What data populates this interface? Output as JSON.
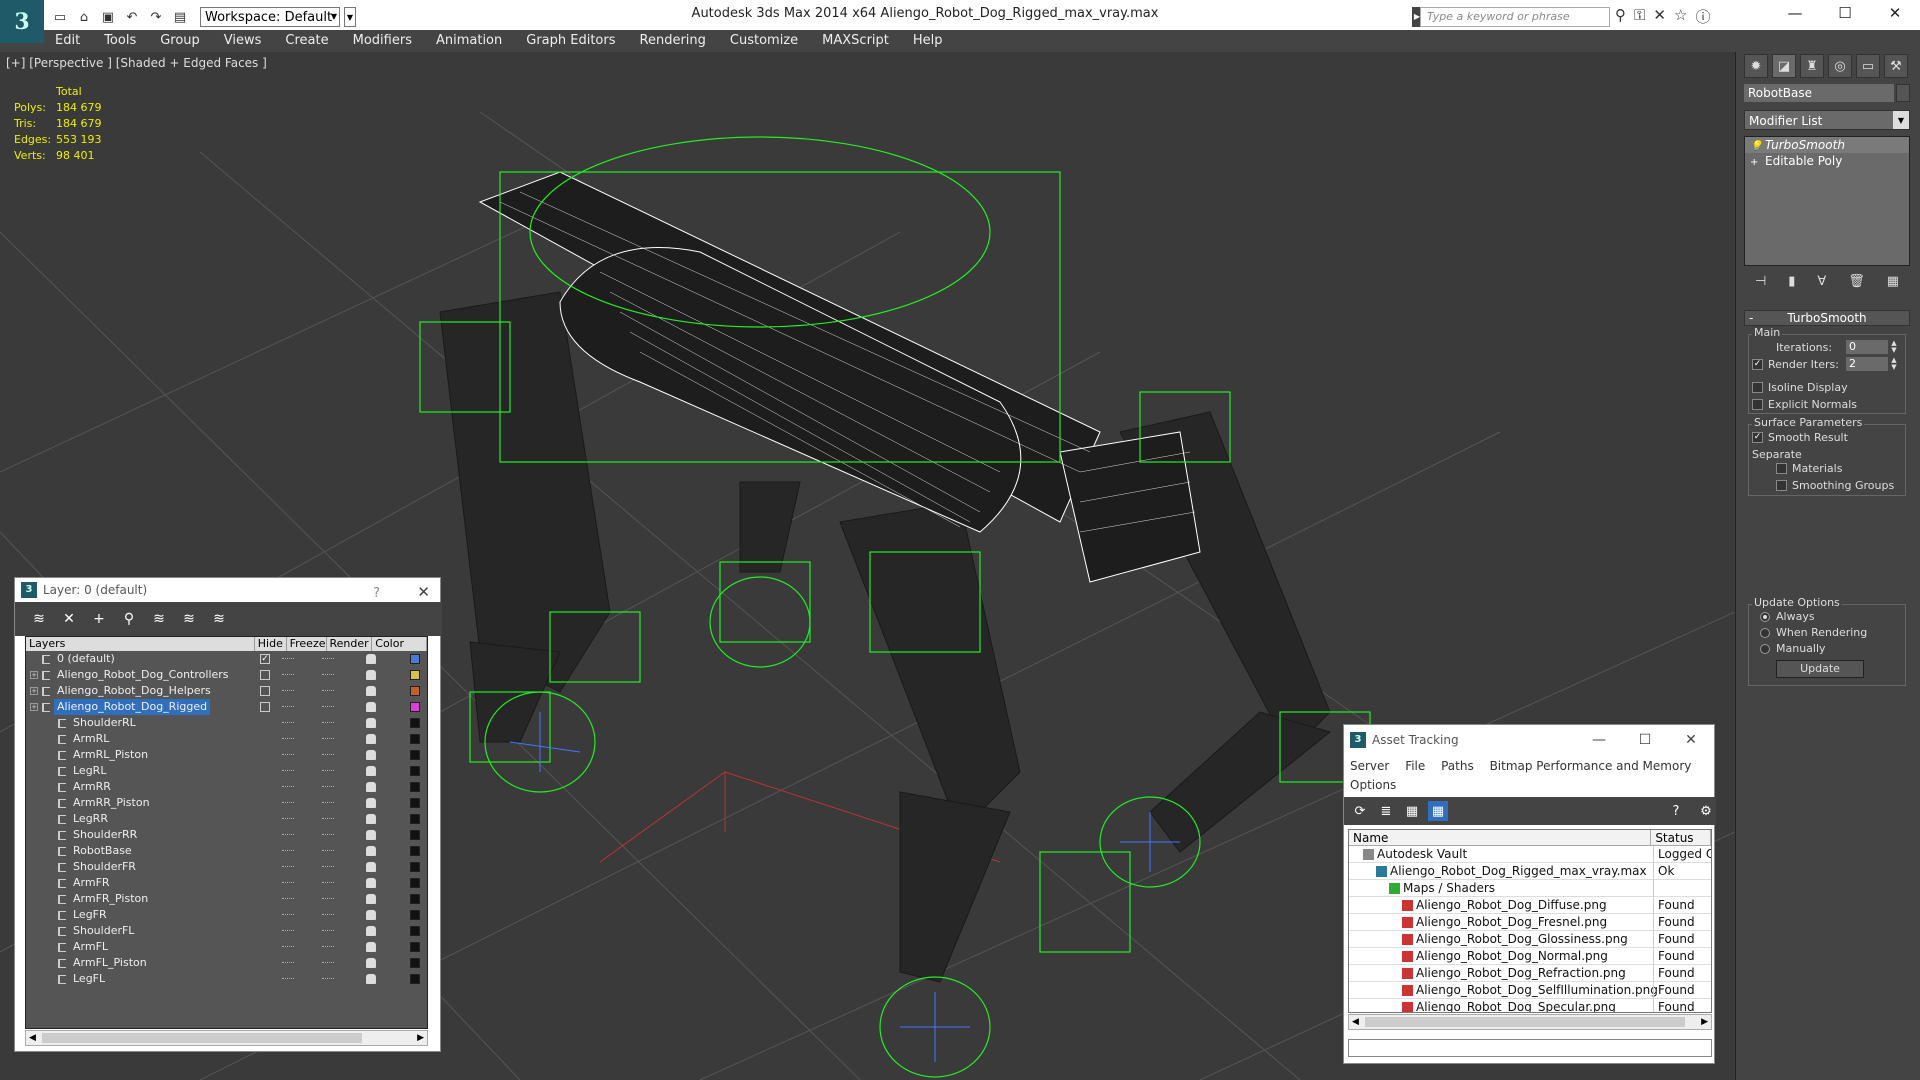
{
  "window": {
    "title": "Autodesk 3ds Max 2014 x64      Aliengo_Robot_Dog_Rigged_max_vray.max",
    "workspace": "Workspace: Default",
    "search_placeholder": "Type a keyword or phrase"
  },
  "menu": [
    "Edit",
    "Tools",
    "Group",
    "Views",
    "Create",
    "Modifiers",
    "Animation",
    "Graph Editors",
    "Rendering",
    "Customize",
    "MAXScript",
    "Help"
  ],
  "viewport": {
    "label": "[+] [Perspective ] [Shaded + Edged Faces ]",
    "stats": {
      "header": "Total",
      "rows": [
        {
          "k": "Polys:",
          "v": "184 679"
        },
        {
          "k": "Tris:",
          "v": "184 679"
        },
        {
          "k": "Edges:",
          "v": "553 193"
        },
        {
          "k": "Verts:",
          "v": "98 401"
        }
      ]
    }
  },
  "command_panel": {
    "object_name": "RobotBase",
    "modifier_list": "Modifier List",
    "stack": [
      "TurboSmooth",
      "Editable Poly"
    ],
    "rollout": "TurboSmooth",
    "main_label": "Main",
    "iterations_label": "Iterations:",
    "iterations_value": "0",
    "render_iters_label": "Render Iters:",
    "render_iters_value": "2",
    "isoline": "Isoline Display",
    "explicit_normals": "Explicit Normals",
    "surface_params": "Surface Parameters",
    "smooth_result": "Smooth Result",
    "separate": "Separate",
    "materials": "Materials",
    "smoothing_groups": "Smoothing Groups",
    "update_options": "Update Options",
    "always": "Always",
    "when_rendering": "When Rendering",
    "manually": "Manually",
    "update_btn": "Update"
  },
  "layer_dialog": {
    "title": "Layer: 0 (default)",
    "help": "?",
    "columns": [
      "Layers",
      "Hide",
      "Freeze",
      "Render",
      "Color"
    ],
    "rows": [
      {
        "name": "0 (default)",
        "level": 0,
        "exp": false,
        "color": "#4a7ad8",
        "current": true
      },
      {
        "name": "Aliengo_Robot_Dog_Controllers",
        "level": 0,
        "exp": true,
        "color": "#d8c04a"
      },
      {
        "name": "Aliengo_Robot_Dog_Helpers",
        "level": 0,
        "exp": true,
        "color": "#c0602a"
      },
      {
        "name": "Aliengo_Robot_Dog_Rigged",
        "level": 0,
        "exp": true,
        "color": "#d840d8",
        "selected": true
      },
      {
        "name": "ShoulderRL",
        "level": 1,
        "color": "#111"
      },
      {
        "name": "ArmRL",
        "level": 1,
        "color": "#111"
      },
      {
        "name": "ArmRL_Piston",
        "level": 1,
        "color": "#111"
      },
      {
        "name": "LegRL",
        "level": 1,
        "color": "#111"
      },
      {
        "name": "ArmRR",
        "level": 1,
        "color": "#111"
      },
      {
        "name": "ArmRR_Piston",
        "level": 1,
        "color": "#111"
      },
      {
        "name": "LegRR",
        "level": 1,
        "color": "#111"
      },
      {
        "name": "ShoulderRR",
        "level": 1,
        "color": "#111"
      },
      {
        "name": "RobotBase",
        "level": 1,
        "color": "#111"
      },
      {
        "name": "ShoulderFR",
        "level": 1,
        "color": "#111"
      },
      {
        "name": "ArmFR",
        "level": 1,
        "color": "#111"
      },
      {
        "name": "ArmFR_Piston",
        "level": 1,
        "color": "#111"
      },
      {
        "name": "LegFR",
        "level": 1,
        "color": "#111"
      },
      {
        "name": "ShoulderFL",
        "level": 1,
        "color": "#111"
      },
      {
        "name": "ArmFL",
        "level": 1,
        "color": "#111"
      },
      {
        "name": "ArmFL_Piston",
        "level": 1,
        "color": "#111"
      },
      {
        "name": "LegFL",
        "level": 1,
        "color": "#111"
      }
    ]
  },
  "asset_dialog": {
    "title": "Asset Tracking",
    "menu": [
      "Server",
      "File",
      "Paths",
      "Bitmap Performance and Memory",
      "Options"
    ],
    "columns": [
      "Name",
      "Status"
    ],
    "rows": [
      {
        "name": "Autodesk Vault",
        "status": "Logged O",
        "level": 0,
        "icon": "vault"
      },
      {
        "name": "Aliengo_Robot_Dog_Rigged_max_vray.max",
        "status": "Ok",
        "level": 1,
        "icon": "file"
      },
      {
        "name": "Maps / Shaders",
        "status": "",
        "level": 2,
        "icon": "folder"
      },
      {
        "name": "Aliengo_Robot_Dog_Diffuse.png",
        "status": "Found",
        "level": 3,
        "icon": "png"
      },
      {
        "name": "Aliengo_Robot_Dog_Fresnel.png",
        "status": "Found",
        "level": 3,
        "icon": "png"
      },
      {
        "name": "Aliengo_Robot_Dog_Glossiness.png",
        "status": "Found",
        "level": 3,
        "icon": "png"
      },
      {
        "name": "Aliengo_Robot_Dog_Normal.png",
        "status": "Found",
        "level": 3,
        "icon": "png"
      },
      {
        "name": "Aliengo_Robot_Dog_Refraction.png",
        "status": "Found",
        "level": 3,
        "icon": "png"
      },
      {
        "name": "Aliengo_Robot_Dog_SelfIllumination.png",
        "status": "Found",
        "level": 3,
        "icon": "png"
      },
      {
        "name": "Aliengo_Robot_Dog_Specular.png",
        "status": "Found",
        "level": 3,
        "icon": "png"
      }
    ]
  }
}
